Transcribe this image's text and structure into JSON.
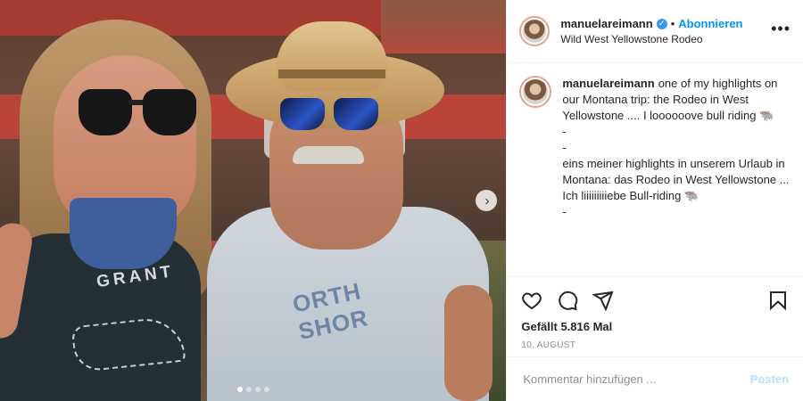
{
  "post": {
    "username": "manuelareimann",
    "verified_icon": "verified-badge-icon",
    "separator": "•",
    "follow_label": "Abonnieren",
    "location": "Wild West Yellowstone Rodeo",
    "more_icon": "more-options-icon",
    "more_label": "•••"
  },
  "caption": {
    "username": "manuelareimann",
    "text": "one of my highlights on our Montana trip: the Rodeo in West Yellowstone .... I loooooove bull riding 🐃\n-\n-\neins meiner highlights in unserem Urlaub in Montana: das Rodeo in West Yellowstone ... Ich liiiiiiiiiebe Bull-riding 🐃\n-"
  },
  "photo": {
    "shirt_left_text": "GRANT",
    "shirt_right_text": "ORTH SHOR",
    "next_icon": "chevron-right-icon",
    "next_label": "›",
    "dots_total": 4,
    "dots_active_index": 0
  },
  "actions": {
    "like_icon": "heart-icon",
    "comment_icon": "comment-icon",
    "share_icon": "share-icon",
    "save_icon": "bookmark-icon",
    "likes_text": "Gefällt 5.816 Mal",
    "date": "10. AUGUST"
  },
  "comment": {
    "placeholder": "Kommentar hinzufügen ...",
    "post_label": "Posten"
  },
  "colors": {
    "accent": "#0095f6",
    "post_disabled": "#b2dffc",
    "muted": "#8e8e8e"
  }
}
